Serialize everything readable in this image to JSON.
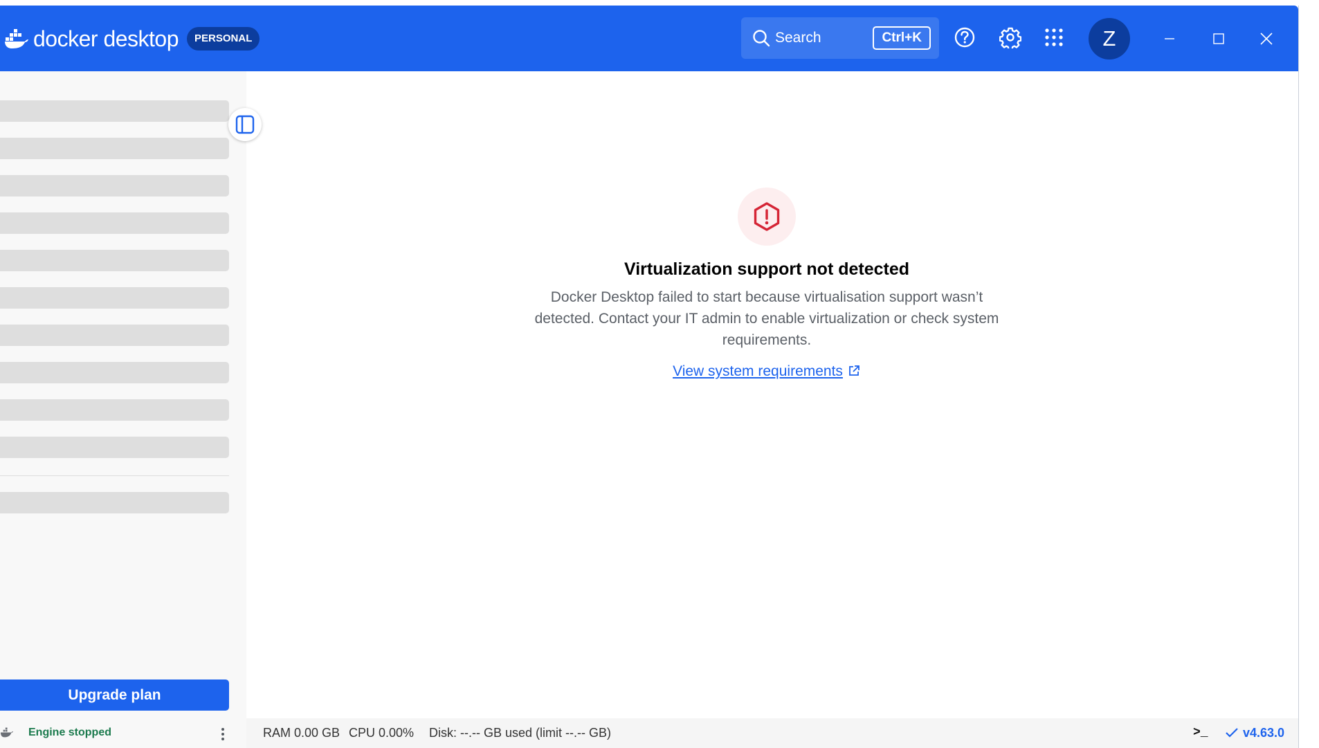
{
  "app": {
    "brand_name": "docker desktop",
    "plan_badge": "PERSONAL"
  },
  "header": {
    "search_label": "Search",
    "search_shortcut": "Ctrl+K",
    "avatar_initial": "Z"
  },
  "sidebar": {
    "upgrade_label": "Upgrade plan",
    "engine_status": "Engine stopped"
  },
  "main": {
    "error_title": "Virtualization support not detected",
    "error_body": "Docker Desktop failed to start because virtualisation support wasn’t detected. Contact your IT admin to enable virtualization or check system requirements.",
    "link_label": "View system requirements"
  },
  "statusbar": {
    "ram": "RAM 0.00 GB",
    "cpu": "CPU 0.00%",
    "disk": "Disk: --.-- GB used (limit --.-- GB)",
    "terminal_glyph": ">_",
    "version": "v4.63.0"
  },
  "colors": {
    "accent": "#1d63ed",
    "badge_bg": "#0c3d9e",
    "error": "#d52536",
    "engine_stopped": "#1b7a4d"
  },
  "icons": {
    "brand": "docker-whale-icon",
    "search": "search-icon",
    "help": "help-icon",
    "settings": "gear-icon",
    "apps": "apps-grid-icon",
    "minimize": "minimize-icon",
    "maximize": "maximize-icon",
    "close": "close-icon",
    "collapse": "sidebar-toggle-icon",
    "error": "warning-hexagon-icon",
    "external": "external-link-icon",
    "terminal": "terminal-icon",
    "check": "check-icon",
    "more": "more-vertical-icon"
  }
}
